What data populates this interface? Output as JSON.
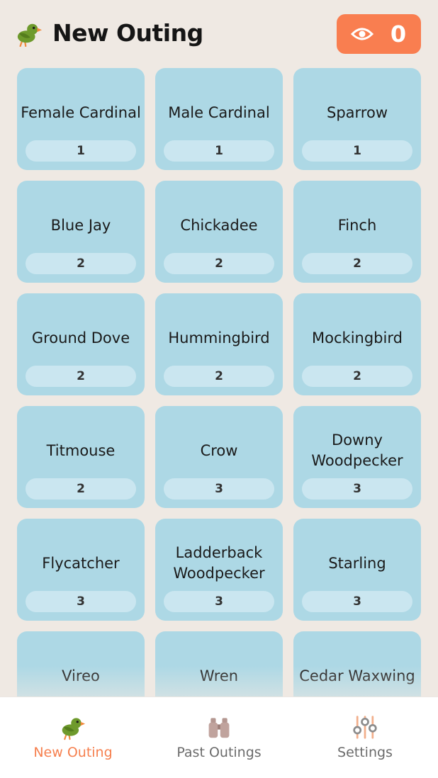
{
  "header": {
    "title": "New Outing",
    "logo_icon": "bird-icon",
    "sightings_icon": "eye-icon",
    "sightings_count": "0"
  },
  "colors": {
    "accent": "#F97E50",
    "tile": "#ADD8E5",
    "tile_badge": "#CAE6F0",
    "background": "#EFE9E3",
    "bird_green": "#6E9A2C"
  },
  "birds": [
    {
      "name": "Female Cardinal",
      "count": "1"
    },
    {
      "name": "Male Cardinal",
      "count": "1"
    },
    {
      "name": "Sparrow",
      "count": "1"
    },
    {
      "name": "Blue Jay",
      "count": "2"
    },
    {
      "name": "Chickadee",
      "count": "2"
    },
    {
      "name": "Finch",
      "count": "2"
    },
    {
      "name": "Ground Dove",
      "count": "2"
    },
    {
      "name": "Hummingbird",
      "count": "2"
    },
    {
      "name": "Mockingbird",
      "count": "2"
    },
    {
      "name": "Titmouse",
      "count": "2"
    },
    {
      "name": "Crow",
      "count": "3"
    },
    {
      "name": "Downy Woodpecker",
      "count": "3"
    },
    {
      "name": "Flycatcher",
      "count": "3"
    },
    {
      "name": "Ladderback Woodpecker",
      "count": "3"
    },
    {
      "name": "Starling",
      "count": "3"
    },
    {
      "name": "Vireo",
      "count": ""
    },
    {
      "name": "Wren",
      "count": ""
    },
    {
      "name": "Cedar Waxwing",
      "count": ""
    }
  ],
  "nav": {
    "items": [
      {
        "label": "New Outing",
        "icon": "bird-icon",
        "active": true
      },
      {
        "label": "Past Outings",
        "icon": "binoculars-icon",
        "active": false
      },
      {
        "label": "Settings",
        "icon": "sliders-icon",
        "active": false
      }
    ]
  }
}
